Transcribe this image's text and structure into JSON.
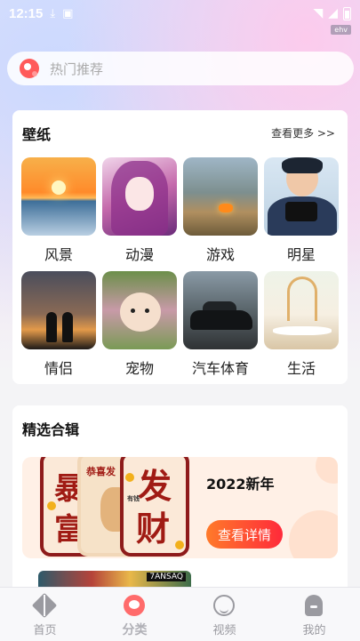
{
  "status": {
    "time": "12:15",
    "badge": "ehv"
  },
  "search": {
    "placeholder": "热门推荐"
  },
  "wallpaper": {
    "title": "壁纸",
    "more": "查看更多 >>",
    "items": [
      {
        "label": "风景"
      },
      {
        "label": "动漫"
      },
      {
        "label": "游戏"
      },
      {
        "label": "明星"
      },
      {
        "label": "情侣"
      },
      {
        "label": "宠物"
      },
      {
        "label": "汽车体育"
      },
      {
        "label": "生活"
      }
    ]
  },
  "collection": {
    "title": "精选合辑",
    "banner": {
      "title": "2022新年",
      "button": "查看详情",
      "poster_text": [
        "暴",
        "富",
        "恭喜发",
        "发",
        "财",
        "有钱"
      ]
    },
    "next_peek_text": "7ANSAQ"
  },
  "tabbar": {
    "items": [
      {
        "label": "首页",
        "icon": "diamond-icon",
        "active": false
      },
      {
        "label": "分类",
        "icon": "category-icon",
        "active": true
      },
      {
        "label": "视频",
        "icon": "face-icon",
        "active": false
      },
      {
        "label": "我的",
        "icon": "profile-icon",
        "active": false
      }
    ]
  },
  "colors": {
    "accent": "#ff3a3a",
    "button_gradient_start": "#ff7a2a",
    "button_gradient_end": "#ff2a3a",
    "tab_inactive": "#9a9aa0"
  }
}
